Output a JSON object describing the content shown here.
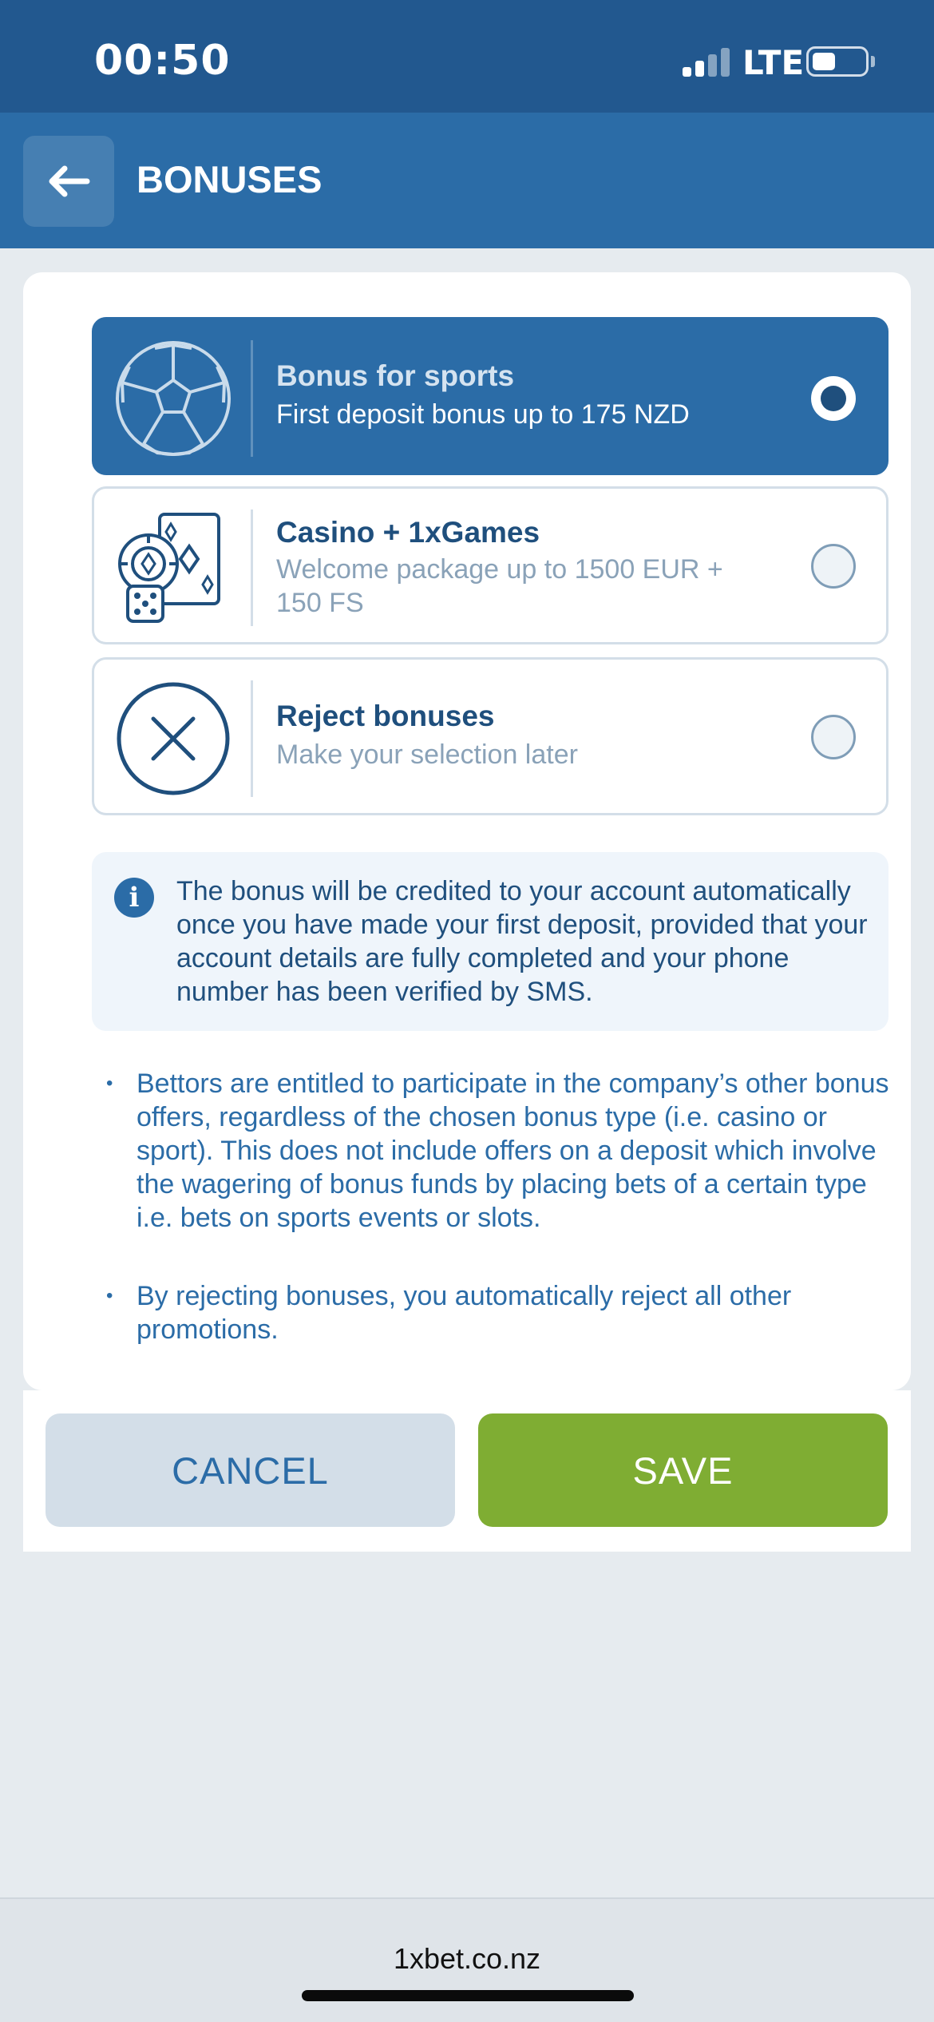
{
  "status_bar": {
    "time": "00:50",
    "network": "LTE"
  },
  "header": {
    "back_icon": "arrow-left-icon",
    "title": "BONUSES"
  },
  "options": [
    {
      "icon": "soccer-ball-icon",
      "title": "Bonus for sports",
      "subtitle": "First deposit bonus up to 175 NZD",
      "selected": true
    },
    {
      "icon": "casino-cards-icon",
      "title": "Casino + 1xGames",
      "subtitle": "Welcome package up to 1500 EUR + 150 FS",
      "selected": false
    },
    {
      "icon": "reject-x-icon",
      "title": "Reject bonuses",
      "subtitle": "Make your selection later",
      "selected": false
    }
  ],
  "info": {
    "icon": "info-icon",
    "text": "The bonus will be credited to your account automatically once you have made your first deposit, provided that your account details are fully completed and your phone number has been verified by SMS."
  },
  "notes": [
    "Bettors are entitled to participate in the company’s other bonus offers, regardless of the chosen bonus type (i.e. casino or sport). This does not include offers on a deposit which involve the wagering of bonus funds by placing bets of a certain type i.e. bets on sports events or slots.",
    "By rejecting bonuses, you automatically reject all other promotions."
  ],
  "buttons": {
    "cancel": "CANCEL",
    "save": "SAVE"
  },
  "browser": {
    "url": "1xbet.co.nz"
  },
  "colors": {
    "brand_blue": "#2b6ca7",
    "status_blue": "#22588f",
    "save_green": "#7fad33",
    "text_dark_blue": "#1f4f7d"
  }
}
